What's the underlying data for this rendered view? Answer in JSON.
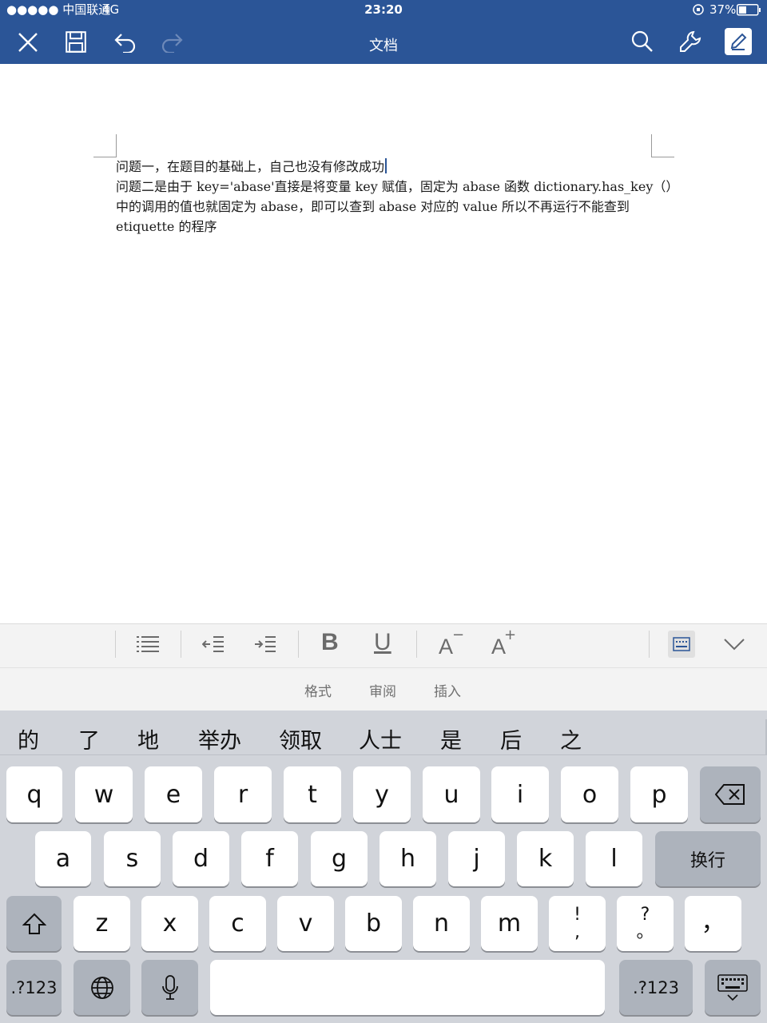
{
  "status_bar": {
    "carrier": "●●●●● 中国联通",
    "network": "4G",
    "time": "23:20",
    "battery": "37%"
  },
  "app_bar": {
    "title": "文档",
    "left_icons": [
      "close-icon",
      "save-icon",
      "undo-icon",
      "redo-icon"
    ],
    "right_icons": [
      "search-icon",
      "wrench-icon",
      "edit-icon"
    ]
  },
  "document": {
    "lines": [
      "问题一，在题目的基础上，自己也没有修改成功",
      "问题二是由于 key='abase'直接是将变量 key 赋值，固定为 abase 函数 dictionary.has_key（）",
      "中的调用的值也就固定为 abase，即可以查到 abase 对应的 value 所以不再运行不能查到",
      "etiquette 的程序"
    ]
  },
  "format_toolbar": {
    "icons": [
      "list-icon",
      "outdent-icon",
      "indent-icon",
      "bold-icon",
      "underline-icon",
      "font-decrease-icon",
      "font-increase-icon",
      "keyboard-layout-icon",
      "collapse-icon"
    ],
    "bold_label": "B",
    "underline_label": "U",
    "decrease_label": "A",
    "decrease_mark": "−",
    "increase_label": "A",
    "increase_mark": "+"
  },
  "tabs": [
    "格式",
    "审阅",
    "插入"
  ],
  "keyboard": {
    "candidates": [
      "的",
      "了",
      "地",
      "举办",
      "领取",
      "人士",
      "是",
      "后",
      "之"
    ],
    "row1": [
      "q",
      "w",
      "e",
      "r",
      "t",
      "y",
      "u",
      "i",
      "o",
      "p"
    ],
    "row2": [
      "a",
      "s",
      "d",
      "f",
      "g",
      "h",
      "j",
      "k",
      "l"
    ],
    "row3": [
      "z",
      "x",
      "c",
      "v",
      "b",
      "n",
      "m"
    ],
    "return_label": "换行",
    "punct1_top": "!",
    "punct1_bottom": ",",
    "punct2_top": "?",
    "punct2_bottom": "。",
    "punct3": "，",
    "numbers_label": ".?123",
    "numbers_label_right": ".?123"
  },
  "colors": {
    "brand": "#2b5597",
    "keyboard_bg": "#d1d4da"
  }
}
